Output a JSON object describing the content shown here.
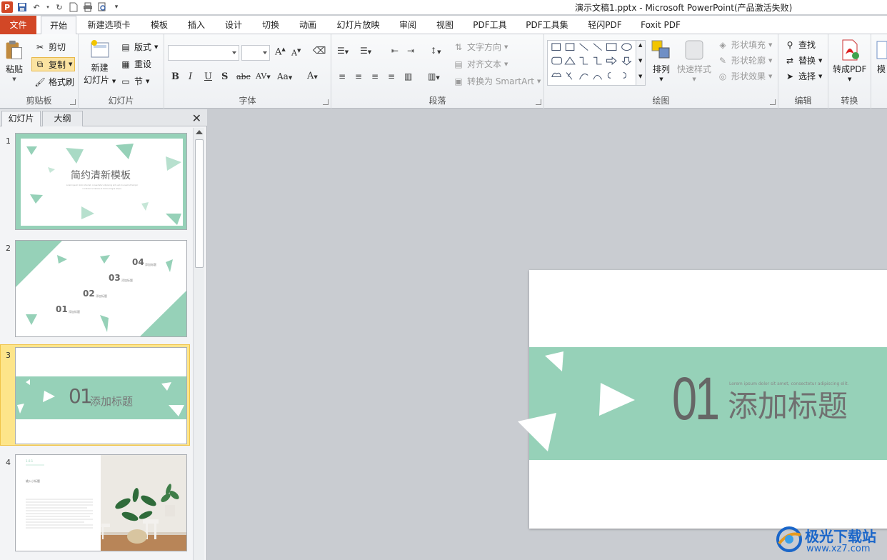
{
  "window": {
    "title": "演示文稿1.pptx  -  Microsoft PowerPoint(产品激活失败)"
  },
  "tabs": {
    "file": "文件",
    "home": "开始",
    "new_tab": "新建选项卡",
    "template": "模板",
    "insert": "插入",
    "design": "设计",
    "transitions": "切换",
    "animations": "动画",
    "slideshow": "幻灯片放映",
    "review": "审阅",
    "view": "视图",
    "pdf_tools": "PDF工具",
    "pdf_toolset": "PDF工具集",
    "light_pdf": "轻闪PDF",
    "foxit_pdf": "Foxit PDF"
  },
  "ribbon": {
    "clipboard": {
      "label": "剪贴板",
      "paste": "粘贴",
      "cut": "剪切",
      "copy": "复制",
      "format_painter": "格式刷"
    },
    "slides": {
      "label": "幻灯片",
      "new_slide_1": "新建",
      "new_slide_2": "幻灯片",
      "layout": "版式",
      "reset": "重设",
      "section": "节"
    },
    "font": {
      "label": "字体"
    },
    "paragraph": {
      "label": "段落",
      "text_direction": "文字方向",
      "align_text": "对齐文本",
      "convert_smartart": "转换为 SmartArt"
    },
    "drawing": {
      "label": "绘图",
      "arrange": "排列",
      "quick_styles": "快速样式",
      "shape_fill": "形状填充",
      "shape_outline": "形状轮廓",
      "shape_effects": "形状效果"
    },
    "editing": {
      "label": "编辑",
      "find": "查找",
      "replace": "替换",
      "select": "选择"
    },
    "convert": {
      "label": "转换",
      "to_pdf": "转成PDF"
    },
    "more": "模"
  },
  "panel": {
    "tab_slides": "幻灯片",
    "tab_outline": "大纲",
    "close": "✕",
    "slides": [
      {
        "number": "1",
        "title": "简约清新模板",
        "text": "Lorem ipsum dolor sit amet, consectetur adipiscing elit, sed do eiusmod tempor incididunt ut labore et dolore magna aliqua."
      },
      {
        "number": "2",
        "items": [
          {
            "num": "01",
            "label": "添加标题"
          },
          {
            "num": "02",
            "label": "添加标题"
          },
          {
            "num": "03",
            "label": "添加标题"
          },
          {
            "num": "04",
            "label": "添加标题"
          }
        ]
      },
      {
        "number": "3",
        "num": "01",
        "title": "添加标题"
      },
      {
        "number": "4",
        "heading": "1.0.1",
        "subheading": "输入小标题"
      }
    ]
  },
  "main_slide": {
    "number": "01",
    "title": "添加标题",
    "subtitle": "Lorem ipsum dolor sit amet, consectetur adipiscing elit."
  },
  "watermark": {
    "line1": "极光下载站",
    "line2": "www.xz7.com"
  },
  "colors": {
    "accent": "#96d1b8",
    "file_tab": "#d24726",
    "selection": "#fde58a",
    "watermark": "#1a66c9"
  }
}
